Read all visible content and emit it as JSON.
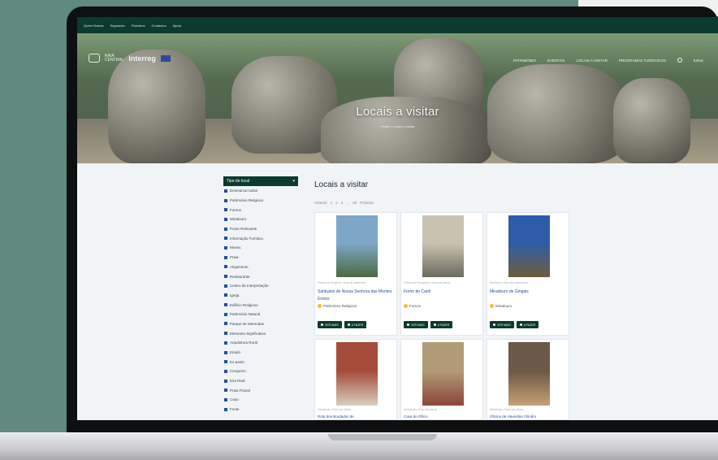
{
  "topbar": {
    "items": [
      "Quem Somos",
      "Segmento",
      "Parceiros",
      "Contactos",
      "Ajuda"
    ]
  },
  "hero": {
    "title": "Locais a visitar",
    "breadcrumb": "Home > Locais a visitar",
    "logo_line1": "RAIA",
    "logo_line2": "CENTRAL",
    "interreg": "Interreg",
    "nav": [
      "PATRIMÓNIO",
      "EVENTOS",
      "LOCAIS A VISITAR",
      "PROGRAMAS TURÍSTICOS"
    ],
    "nav_icon": "user-icon",
    "nav_login": "Entrar"
  },
  "sidebar": {
    "header": "Tipo de local",
    "items": [
      "Desmarcar todos",
      "Património Religioso",
      "Fornos",
      "Miradouro",
      "Ponto Relevante",
      "Informação Turística",
      "Museu",
      "Praia",
      "Alojamento",
      "Restaurante",
      "Centro de Interpretação",
      "Igreja",
      "Edifício Religioso",
      "Património Natural",
      "Parque de Merendas",
      "Elemento Significativo",
      "Arquitetura Rural",
      "Eirado",
      "Ex-pasto",
      "Cerqueiro",
      "Eira Real",
      "Praia Fluvial",
      "Cepo",
      "Fonte"
    ]
  },
  "main": {
    "title": "Locais a visitar",
    "pager": [
      "Anterior",
      "1",
      "2",
      "3",
      "...",
      "28",
      "Próxima"
    ],
    "cards": [
      {
        "title": "Santuário de Nossa Senhora das Montes Ermos",
        "category": "Património Religioso",
        "meta": "Património Religioso • Rota do património",
        "photo": "#7ea6c7",
        "photo2": "#4a6b3f"
      },
      {
        "title": "Forno do Carril",
        "category": "Fornos",
        "meta": "Património Etnográfico • Rota dos fornos",
        "photo": "#c9c2b0",
        "photo2": "#6b6a5f"
      },
      {
        "title": "Miradouro de Gingais",
        "category": "Miradouro",
        "meta": "Miradouro • Rota dos miradouros",
        "photo": "#2e5da8",
        "photo2": "#6e5d3b"
      },
      {
        "title": "Rota dos Bordados de",
        "category": "",
        "meta": "Artesanato • Rota dos ofícios",
        "photo": "#a44b3a",
        "photo2": "#d8cfbf"
      },
      {
        "title": "Casa do Ofício",
        "category": "",
        "meta": "Artesanato • Rota dos ofícios",
        "photo": "#b29a79",
        "photo2": "#8c4636"
      },
      {
        "title": "Oficina de Haverdas Cilindro",
        "category": "",
        "meta": "Artesanato • Rota dos ofícios",
        "photo": "#6b5846",
        "photo2": "#c7a173"
      }
    ],
    "btn_more": "VER MAIS",
    "btn_todo": "A FAZER"
  }
}
